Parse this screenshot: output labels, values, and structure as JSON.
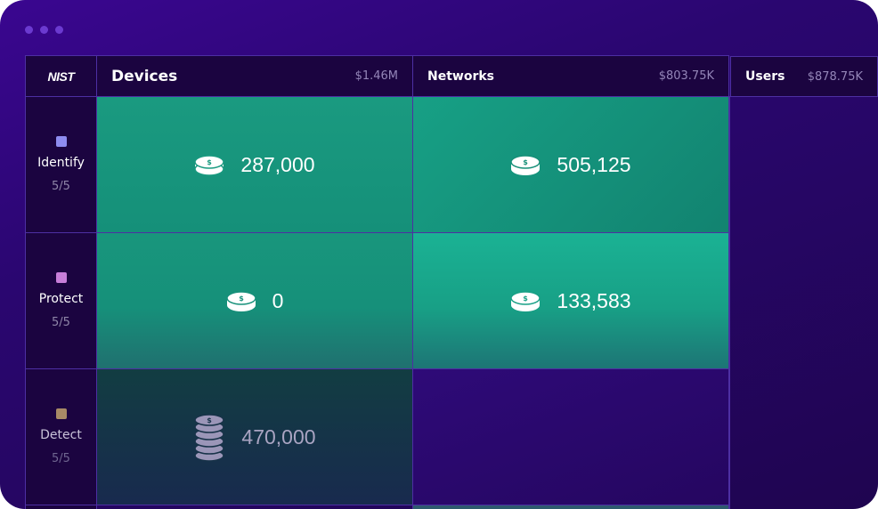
{
  "brand": {
    "logo": "NIST"
  },
  "columns": [
    {
      "name": "Devices",
      "amount": "$1.46M"
    },
    {
      "name": "Networks",
      "amount": "$803.75K"
    },
    {
      "name": "Users",
      "amount": "$878.75K"
    }
  ],
  "rows": [
    {
      "label": "Identify",
      "count": "5/5",
      "color": "#8e8cf0"
    },
    {
      "label": "Protect",
      "count": "5/5",
      "color": "#c77ed9"
    },
    {
      "label": "Detect",
      "count": "5/5",
      "color": "#a88a66"
    }
  ],
  "cells": {
    "identify_devices": "287,000",
    "identify_networks": "505,125",
    "protect_devices": "0",
    "protect_networks": "133,583",
    "detect_devices": "470,000"
  },
  "icons": {
    "coin": "coin-icon",
    "coin_stack": "coin-stack-icon"
  },
  "colors": {
    "teal": "#169a80",
    "dark_teal": "#123d42",
    "background": "#2a0670"
  }
}
